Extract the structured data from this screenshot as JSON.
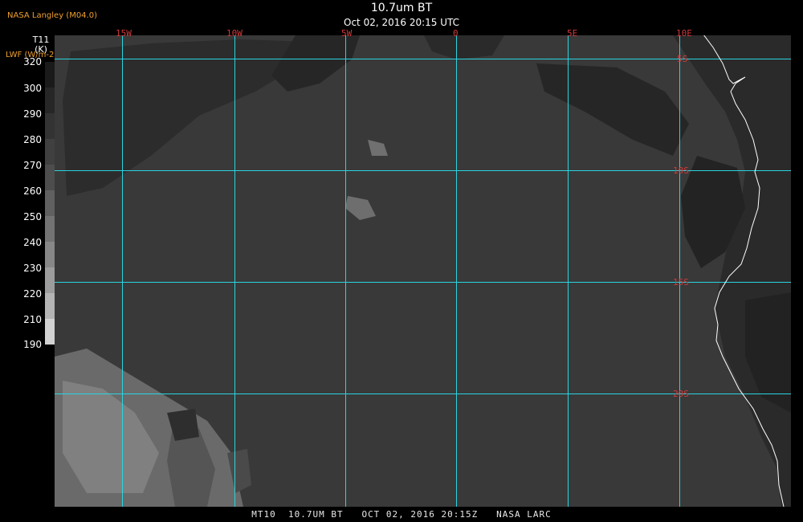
{
  "header": {
    "credit": "NASA Langley (M04.0)",
    "title": "10.7um BT",
    "subtitle": "Oct 02, 2016 20:15 UTC"
  },
  "colorbar": {
    "variable": "T11",
    "unit": "(K)",
    "secondary_label": "LWF (W/m-2)",
    "ticks": [
      "320",
      "300",
      "290",
      "280",
      "270",
      "260",
      "250",
      "240",
      "230",
      "220",
      "210",
      "190"
    ],
    "shades": [
      "#1a1a1a",
      "#262626",
      "#333333",
      "#404040",
      "#4d4d4d",
      "#606060",
      "#737373",
      "#878787",
      "#9c9c9c",
      "#b4b4b4",
      "#d2d2d2"
    ]
  },
  "map": {
    "grid_color": "#2ad4e0",
    "label_color": "#d23a3a",
    "coast_color": "#ffffff",
    "longitude_labels": [
      "15W",
      "10W",
      "5W",
      "0",
      "5E",
      "10E"
    ],
    "latitude_labels": [
      "5S",
      "10S",
      "15S",
      "20S"
    ]
  },
  "footer": {
    "caption": "MT10  10.7UM BT   OCT 02, 2016 20:15Z   NASA LARC"
  }
}
